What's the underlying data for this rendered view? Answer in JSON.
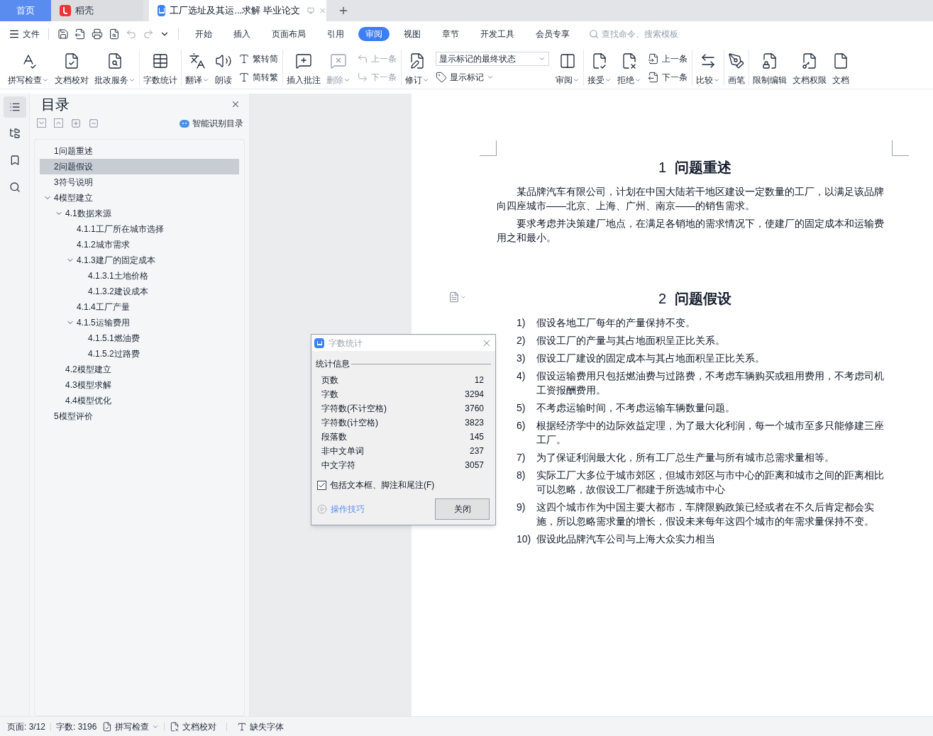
{
  "browser_tabs": [
    {
      "kind": "home",
      "label": "首页",
      "selected": false
    },
    {
      "kind": "app",
      "label": "稻壳",
      "selected": false
    },
    {
      "kind": "doc",
      "label": "工厂选址及其运...求解 毕业论文",
      "selected": true
    }
  ],
  "menu": {
    "file": "文件",
    "tabs": [
      {
        "label": "开始",
        "selected": false
      },
      {
        "label": "插入",
        "selected": false
      },
      {
        "label": "页面布局",
        "selected": false
      },
      {
        "label": "引用",
        "selected": false
      },
      {
        "label": "审阅",
        "selected": true
      },
      {
        "label": "视图",
        "selected": false
      },
      {
        "label": "章节",
        "selected": false
      },
      {
        "label": "开发工具",
        "selected": false
      },
      {
        "label": "会员专享",
        "selected": false
      }
    ],
    "search": {
      "placeholder": "查找命令、搜索模板"
    }
  },
  "ribbon": [
    {
      "kind": "big",
      "label": "拼写检查",
      "dropdown": true,
      "disabled": false
    },
    {
      "kind": "big",
      "label": "文档校对",
      "dropdown": false,
      "disabled": false
    },
    {
      "kind": "big",
      "label": "批改服务",
      "dropdown": true,
      "disabled": false
    },
    {
      "kind": "separator"
    },
    {
      "kind": "big",
      "label": "字数统计",
      "dropdown": false,
      "disabled": false
    },
    {
      "kind": "separator"
    },
    {
      "kind": "big",
      "label": "翻译",
      "dropdown": true,
      "disabled": false
    },
    {
      "kind": "big",
      "label": "朗读",
      "dropdown": false,
      "disabled": false
    },
    {
      "kind": "pair",
      "rows": [
        {
          "label": "繁转简",
          "disabled": false
        },
        {
          "label": "简转繁",
          "disabled": false
        }
      ]
    },
    {
      "kind": "separator"
    },
    {
      "kind": "big",
      "label": "插入批注",
      "dropdown": false,
      "disabled": false
    },
    {
      "kind": "big",
      "label": "删除",
      "dropdown": true,
      "disabled": true
    },
    {
      "kind": "pair",
      "rows": [
        {
          "label": "上一条",
          "disabled": true
        },
        {
          "label": "下一条",
          "disabled": true
        }
      ]
    },
    {
      "kind": "separator"
    },
    {
      "kind": "big",
      "label": "修订",
      "dropdown": true,
      "disabled": false
    },
    {
      "kind": "select",
      "value": "显示标记的最终状态",
      "below": "显示标记"
    },
    {
      "kind": "big",
      "label": "审阅",
      "dropdown": true,
      "disabled": false
    },
    {
      "kind": "separator"
    },
    {
      "kind": "big",
      "label": "接受",
      "dropdown": true,
      "disabled": false
    },
    {
      "kind": "big",
      "label": "拒绝",
      "dropdown": true,
      "disabled": false
    },
    {
      "kind": "pair",
      "rows": [
        {
          "label": "上一条",
          "disabled": false
        },
        {
          "label": "下一条",
          "disabled": false
        }
      ]
    },
    {
      "kind": "separator"
    },
    {
      "kind": "big",
      "label": "比较",
      "dropdown": true,
      "disabled": false
    },
    {
      "kind": "separator"
    },
    {
      "kind": "big",
      "label": "画笔",
      "dropdown": false,
      "disabled": false
    },
    {
      "kind": "separator"
    },
    {
      "kind": "big",
      "label": "限制编辑",
      "dropdown": false,
      "disabled": false
    },
    {
      "kind": "big",
      "label": "文档权限",
      "dropdown": false,
      "disabled": false
    },
    {
      "kind": "big",
      "label": "文档",
      "dropdown": false,
      "disabled": false
    }
  ],
  "toc": {
    "title": "目录",
    "smart_button": "智能识别目录",
    "items": [
      {
        "label": "1问题重述",
        "selected": false
      },
      {
        "label": "2问题假设",
        "selected": true
      },
      {
        "label": "3符号说明",
        "selected": false
      },
      {
        "label": "4模型建立",
        "selected": false,
        "expanded": true,
        "children": [
          {
            "label": "4.1数据来源",
            "selected": false,
            "expanded": true,
            "children": [
              {
                "label": "4.1.1工厂所在城市选择",
                "selected": false
              },
              {
                "label": "4.1.2城市需求",
                "selected": false
              },
              {
                "label": "4.1.3建厂的固定成本",
                "selected": false,
                "expanded": true,
                "children": [
                  {
                    "label": "4.1.3.1土地价格",
                    "selected": false
                  },
                  {
                    "label": "4.1.3.2建设成本",
                    "selected": false
                  }
                ]
              },
              {
                "label": "4.1.4工厂产量",
                "selected": false
              },
              {
                "label": "4.1.5运输费用",
                "selected": false,
                "expanded": true,
                "children": [
                  {
                    "label": "4.1.5.1燃油费",
                    "selected": false
                  },
                  {
                    "label": "4.1.5.2过路费",
                    "selected": false
                  }
                ]
              }
            ]
          },
          {
            "label": "4.2模型建立",
            "selected": false
          },
          {
            "label": "4.3模型求解",
            "selected": false
          },
          {
            "label": "4.4模型优化",
            "selected": false
          }
        ]
      },
      {
        "label": "5模型评价",
        "selected": false
      }
    ]
  },
  "document": {
    "sections": [
      {
        "number": "1",
        "title": "问题重述",
        "kind": "paragraphs",
        "paragraphs": [
          "某品牌汽车有限公司，计划在中国大陆若干地区建设一定数量的工厂，以满足该品牌向四座城市——北京、上海、广州、南京——的销售需求。",
          "要求考虑并决策建厂地点，在满足各销地的需求情况下，使建厂的固定成本和运输费用之和最小。"
        ]
      },
      {
        "number": "2",
        "title": "问题假设",
        "kind": "list",
        "items": [
          {
            "number": "1)",
            "text": "假设各地工厂每年的产量保持不变。"
          },
          {
            "number": "2)",
            "text": "假设工厂的产量与其占地面积呈正比关系。"
          },
          {
            "number": "3)",
            "text": "假设工厂建设的固定成本与其占地面积呈正比关系。"
          },
          {
            "number": "4)",
            "text": "假设运输费用只包括燃油费与过路费，不考虑车辆购买或租用费用，不考虑司机工资报酬费用。"
          },
          {
            "number": "5)",
            "text": "不考虑运输时间，不考虑运输车辆数量问题。"
          },
          {
            "number": "6)",
            "text": "根据经济学中的边际效益定理，为了最大化利润，每一个城市至多只能修建三座工厂。"
          },
          {
            "number": "7)",
            "text": "为了保证利润最大化，所有工厂总生产量与所有城市总需求量相等。"
          },
          {
            "number": "8)",
            "text": "实际工厂大多位于城市郊区，但城市郊区与市中心的距离和城市之间的距离相比可以忽略，故假设工厂都建于所选城市中心"
          },
          {
            "number": "9)",
            "text": "这四个城市作为中国主要大都市，车牌限购政策已经或者在不久后肯定都会实施，所以忽略需求量的增长，假设未来每年这四个城市的年需求量保持不变。"
          },
          {
            "number": "10)",
            "text": "假设此品牌汽车公司与上海大众实力相当"
          }
        ]
      }
    ]
  },
  "dialog": {
    "title": "字数统计",
    "section": "统计信息",
    "stats": [
      {
        "label": "页数",
        "value": "12"
      },
      {
        "label": "字数",
        "value": "3294"
      },
      {
        "label": "字符数(不计空格)",
        "value": "3760"
      },
      {
        "label": "字符数(计空格)",
        "value": "3823"
      },
      {
        "label": "段落数",
        "value": "145"
      },
      {
        "label": "非中文单词",
        "value": "237"
      },
      {
        "label": "中文字符",
        "value": "3057"
      }
    ],
    "checkbox": {
      "label": "包括文本框、脚注和尾注(F)",
      "checked": true
    },
    "tips_link": "操作技巧",
    "close_button": "关闭"
  },
  "status_bar": {
    "page": "页面: 3/12",
    "words": "字数: 3196",
    "spell_check": "拼写检查",
    "proofread": "文档校对",
    "missing_fonts": "缺失字体"
  }
}
